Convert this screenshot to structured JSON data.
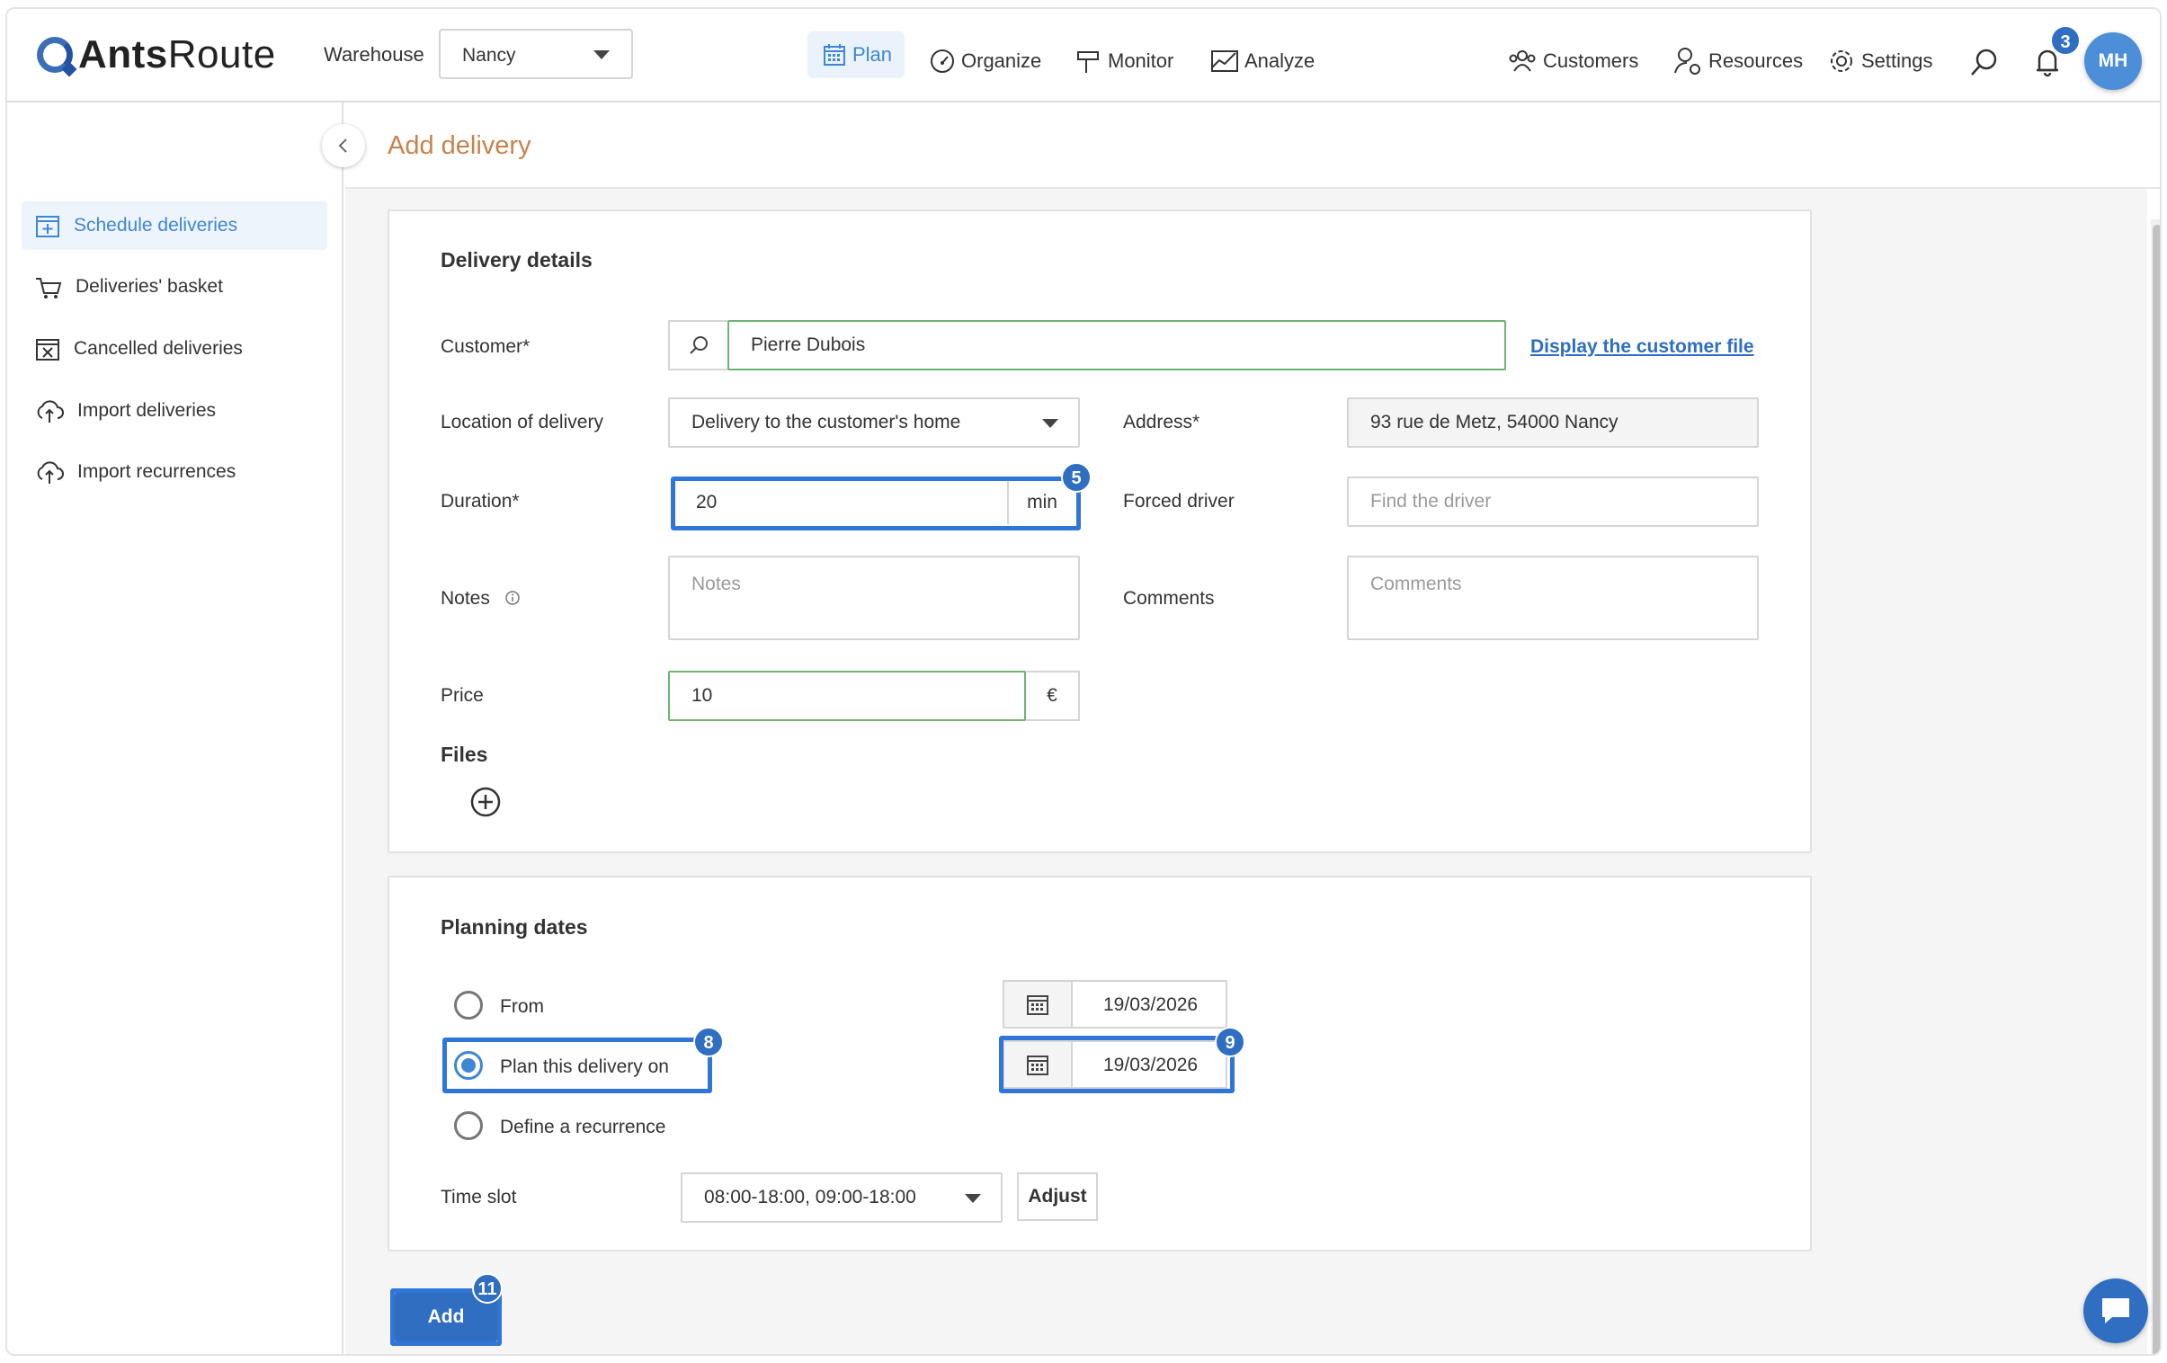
{
  "brand": {
    "name_bold": "Ants",
    "name_rest": "Route"
  },
  "header": {
    "warehouse_label": "Warehouse",
    "warehouse_value": "Nancy",
    "nav": {
      "plan": "Plan",
      "organize": "Organize",
      "monitor": "Monitor",
      "analyze": "Analyze"
    },
    "customers": "Customers",
    "resources": "Resources",
    "settings": "Settings",
    "notification_count": "3",
    "avatar_initials": "MH"
  },
  "sidebar": {
    "items": [
      {
        "label": "Schedule deliveries",
        "icon": "calendar-plus-icon",
        "active": true
      },
      {
        "label": "Deliveries' basket",
        "icon": "basket-icon"
      },
      {
        "label": "Cancelled deliveries",
        "icon": "calendar-x-icon"
      },
      {
        "label": "Import deliveries",
        "icon": "cloud-upload-icon"
      },
      {
        "label": "Import recurrences",
        "icon": "cloud-upload-icon"
      }
    ]
  },
  "page": {
    "title": "Add delivery"
  },
  "delivery_details": {
    "title": "Delivery details",
    "customer_label": "Customer*",
    "customer_value": "Pierre Dubois",
    "customer_link": "Display the customer file",
    "location_label": "Location of delivery",
    "location_value": "Delivery to the customer's home",
    "address_label": "Address*",
    "address_value": "93 rue de Metz, 54000 Nancy",
    "duration_label": "Duration*",
    "duration_value": "20",
    "duration_unit": "min",
    "forced_driver_label": "Forced driver",
    "forced_driver_placeholder": "Find the driver",
    "notes_label": "Notes",
    "notes_placeholder": "Notes",
    "comments_label": "Comments",
    "comments_placeholder": "Comments",
    "price_label": "Price",
    "price_value": "10",
    "currency": "€",
    "files_label": "Files"
  },
  "planning": {
    "title": "Planning dates",
    "options": {
      "from": "From",
      "plan_on": "Plan this delivery on",
      "recurrence": "Define a recurrence"
    },
    "selected": "plan_on",
    "from_date": "19/03/2026",
    "plan_date": "19/03/2026",
    "time_slot_label": "Time slot",
    "time_slot_value": "08:00-18:00, 09:00-18:00",
    "adjust_label": "Adjust"
  },
  "actions": {
    "add_label": "Add"
  },
  "step_markers": {
    "duration": "5",
    "plan_option": "8",
    "plan_date": "9",
    "add": "11"
  },
  "colors": {
    "accent": "#3f86d4",
    "primary": "#2f6ec1",
    "title_orange": "#c8824e",
    "valid_green": "#6fb36f"
  }
}
